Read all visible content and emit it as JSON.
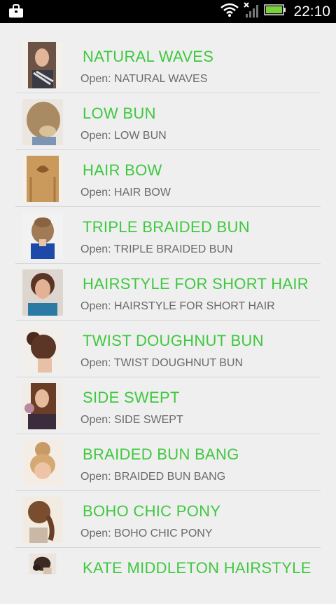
{
  "status_bar": {
    "time": "22:10",
    "icons": [
      "shopping-bag-icon",
      "wifi-icon",
      "no-signal-icon",
      "battery-icon"
    ]
  },
  "colors": {
    "title_green": "#3fc83f",
    "subtitle_gray": "#6a6a6a",
    "background": "#efefef"
  },
  "items": [
    {
      "title": "NATURAL WAVES",
      "subtitle": "Open: NATURAL WAVES"
    },
    {
      "title": "LOW BUN",
      "subtitle": "Open: LOW BUN"
    },
    {
      "title": "HAIR BOW",
      "subtitle": "Open: HAIR BOW"
    },
    {
      "title": "TRIPLE BRAIDED BUN",
      "subtitle": "Open: TRIPLE BRAIDED BUN"
    },
    {
      "title": "HAIRSTYLE FOR SHORT HAIR",
      "subtitle": "Open: HAIRSTYLE FOR SHORT HAIR"
    },
    {
      "title": "TWIST DOUGHNUT BUN",
      "subtitle": "Open: TWIST DOUGHNUT BUN"
    },
    {
      "title": "SIDE SWEPT",
      "subtitle": "Open: SIDE SWEPT"
    },
    {
      "title": "BRAIDED BUN BANG",
      "subtitle": "Open: BRAIDED BUN BANG"
    },
    {
      "title": "BOHO CHIC PONY",
      "subtitle": "Open: BOHO CHIC PONY"
    },
    {
      "title": "KATE MIDDLETON HAIRSTYLE",
      "subtitle": ""
    }
  ]
}
